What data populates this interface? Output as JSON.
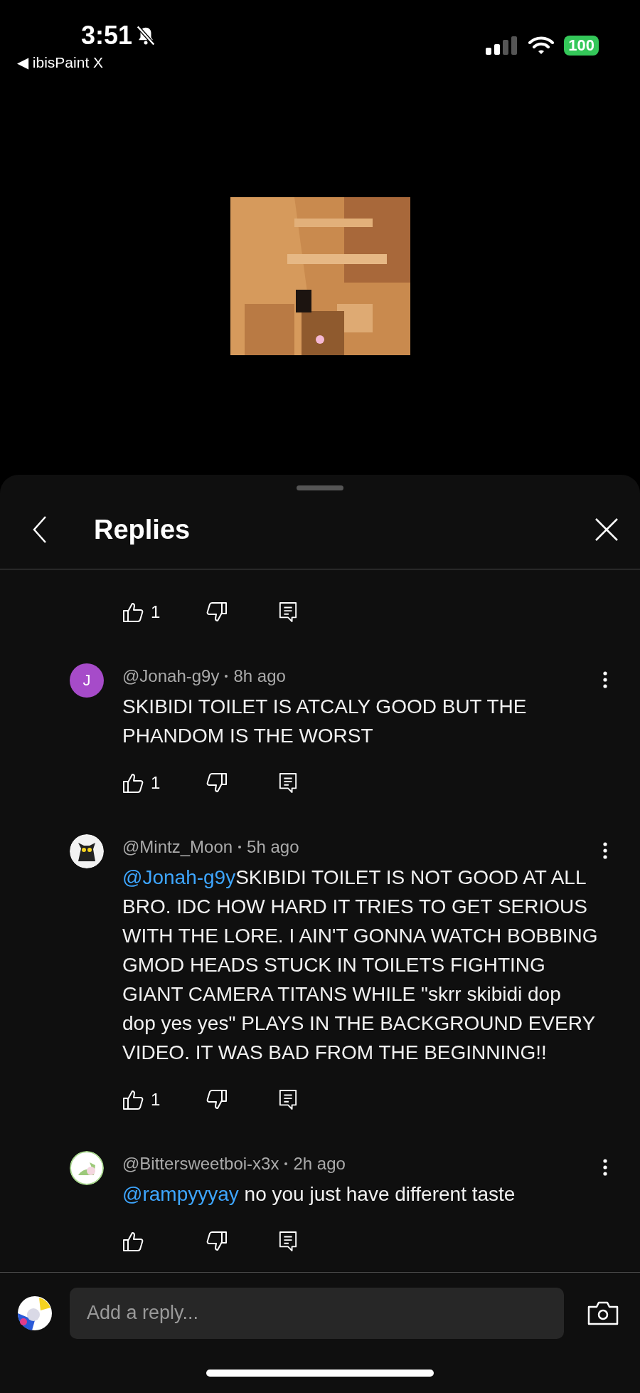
{
  "status_bar": {
    "time": "3:51",
    "back_glyph": "◀",
    "back_app": "ibisPaint X",
    "battery": "100",
    "silent": true
  },
  "panel": {
    "title": "Replies"
  },
  "top_actions": {
    "likes": "1"
  },
  "comments": [
    {
      "avatar": {
        "kind": "letter",
        "letter": "J",
        "color": "#a64bc9"
      },
      "author": "@Jonah-g9y",
      "time": "8h ago",
      "text": "SKIBIDI TOILET IS ATCALY GOOD BUT THE PHANDOM IS THE WORST",
      "likes": "1"
    },
    {
      "avatar": {
        "kind": "cat"
      },
      "author": "@Mintz_Moon",
      "time": "5h ago",
      "mention": "@Jonah-g9y",
      "text": "SKIBIDI TOILET IS NOT GOOD AT ALL BRO. IDC HOW HARD IT TRIES TO GET SERIOUS WITH THE LORE. I AIN'T GONNA WATCH BOBBING GMOD HEADS STUCK IN TOILETS FIGHTING GIANT CAMERA TITANS WHILE \"skrr skibidi dop dop yes yes\" PLAYS IN THE BACKGROUND EVERY VIDEO. IT WAS BAD FROM THE BEGINNING!!",
      "likes": "1"
    },
    {
      "avatar": {
        "kind": "creature"
      },
      "author": "@Bittersweetboi-x3x",
      "time": "2h ago",
      "mention": "@rampyyyay",
      "text": " no you just have different taste"
    }
  ],
  "reply_box": {
    "placeholder": "Add a reply..."
  }
}
